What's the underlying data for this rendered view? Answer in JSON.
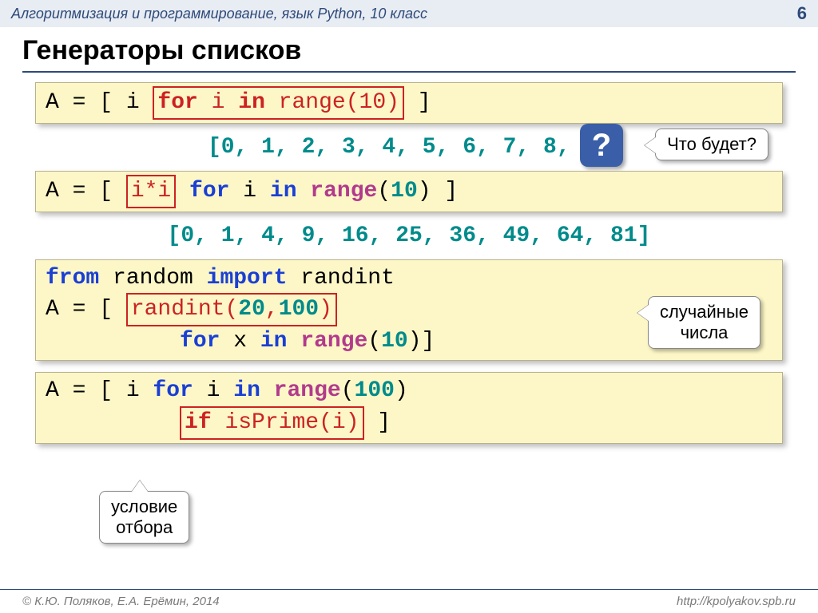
{
  "header": {
    "subject": "Алгоритмизация и программирование, язык Python, 10 класс",
    "page": "6"
  },
  "title": "Генераторы списков",
  "code1": {
    "pre": "A = [ i ",
    "boxed_pre": "for",
    "boxed_mid": " i ",
    "boxed_kw": "in",
    "boxed_fn": " range",
    "boxed_open": "(",
    "boxed_num": "10",
    "boxed_close": ")",
    "post": " ]"
  },
  "output1": "[0, 1, 2, 3, 4, 5, 6, 7, 8, 9]",
  "callout_q": "Что будет?",
  "qmark": "?",
  "code2": {
    "pre": "A = [ ",
    "boxed": "i*i",
    "post_kw1": " for",
    "post_mid": " i ",
    "post_kw2": "in",
    "post_fn": " range",
    "post_open": "(",
    "post_num": "10",
    "post_close": ") ]"
  },
  "output2": "[0, 1, 4, 9, 16, 25, 36, 49, 64, 81]",
  "code3": {
    "l1_kw1": "from",
    "l1_mod": " random ",
    "l1_kw2": "import",
    "l1_name": " randint",
    "l2_pre": "A = [ ",
    "l2_boxed_fn": "randint",
    "l2_boxed_open": "(",
    "l2_boxed_n1": "20",
    "l2_boxed_comma": ",",
    "l2_boxed_n2": "100",
    "l2_boxed_close": ")",
    "l3_indent": "          ",
    "l3_kw1": "for",
    "l3_mid": " x ",
    "l3_kw2": "in",
    "l3_fn": " range",
    "l3_open": "(",
    "l3_num": "10",
    "l3_close": ")]"
  },
  "callout_random": "случайные\nчисла",
  "code4": {
    "l1_pre": "A = [ i ",
    "l1_kw1": "for",
    "l1_mid": " i ",
    "l1_kw2": "in",
    "l1_fn": " range",
    "l1_open": "(",
    "l1_num": "100",
    "l1_close": ")",
    "l2_indent": "          ",
    "l2_boxed_kw": "if",
    "l2_boxed_fn": " isPrime",
    "l2_boxed_open": "(",
    "l2_boxed_arg": "i",
    "l2_boxed_close": ")",
    "l2_post": " ]"
  },
  "callout_filter": "условие\nотбора",
  "footer": {
    "left": "© К.Ю. Поляков, Е.А. Ерёмин, 2014",
    "right": "http://kpolyakov.spb.ru"
  }
}
